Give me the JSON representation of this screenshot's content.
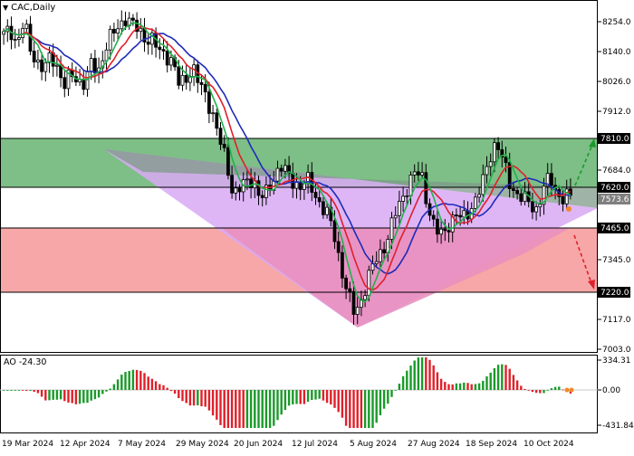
{
  "window": {
    "title": "CAC,Daily"
  },
  "colors": {
    "zone_green": "#7dbf86",
    "zone_red": "#f7a7a7",
    "triangle_purple": "#d8a9f5",
    "triangle_overlap_pink": "#e990c0",
    "triangle_overlap_gray": "#8aa38e",
    "ma_fast": "#22b14c",
    "ma_mid": "#e0202a",
    "ma_slow": "#1e2bb8",
    "osc_positive": "#1a9a2a",
    "osc_negative": "#e0202a",
    "arrow_up": "#1a9a2a",
    "arrow_down": "#e0202a"
  },
  "price_axis": {
    "ticks": [
      "8254.0",
      "8140.0",
      "8026.0",
      "7912.0",
      "7684.0",
      "7345.0",
      "7117.0",
      "7003.0"
    ]
  },
  "level_labels": [
    {
      "name": "resistance-upper",
      "value": "7810.0"
    },
    {
      "name": "resistance-lower",
      "value": "7620.0"
    },
    {
      "name": "current-price",
      "value": "7573.6"
    },
    {
      "name": "support-upper",
      "value": "7465.0"
    },
    {
      "name": "support-lower",
      "value": "7220.0"
    }
  ],
  "oscillator": {
    "label": "AO -24.30",
    "ticks": [
      "334.31",
      "0.00",
      "-431.84"
    ]
  },
  "date_axis": {
    "labels": [
      "19 Mar 2024",
      "12 Apr 2024",
      "7 May 2024",
      "29 May 2024",
      "20 Jun 2024",
      "12 Jul 2024",
      "5 Aug 2024",
      "27 Aug 2024",
      "18 Sep 2024",
      "10 Oct 2024"
    ]
  },
  "chart_data": {
    "type": "candlestick",
    "title": "CAC,Daily",
    "ylim": [
      6990,
      8300
    ],
    "zones": [
      {
        "name": "resistance",
        "from": 7620,
        "to": 7810,
        "color": "green"
      },
      {
        "name": "support",
        "from": 7220,
        "to": 7465,
        "color": "red"
      }
    ],
    "close_path": [
      8180,
      8200,
      8150,
      8230,
      8120,
      8080,
      8050,
      8100,
      8060,
      7990,
      8030,
      8010,
      8000,
      8070,
      8040,
      8130,
      8180,
      8210,
      8250,
      8220,
      8200,
      8170,
      8160,
      8120,
      8110,
      8080,
      7990,
      8020,
      8060,
      7990,
      7950,
      7880,
      7780,
      7700,
      7580,
      7600,
      7620,
      7640,
      7560,
      7580,
      7640,
      7690,
      7650,
      7620,
      7610,
      7630,
      7580,
      7540,
      7500,
      7420,
      7300,
      7200,
      7120,
      7180,
      7260,
      7320,
      7360,
      7420,
      7500,
      7560,
      7620,
      7660,
      7640,
      7520,
      7440,
      7420,
      7470,
      7500,
      7480,
      7520,
      7560,
      7620,
      7720,
      7780,
      7700,
      7620,
      7580,
      7560,
      7540,
      7520,
      7600,
      7640,
      7580,
      7560,
      7573.6
    ]
  }
}
